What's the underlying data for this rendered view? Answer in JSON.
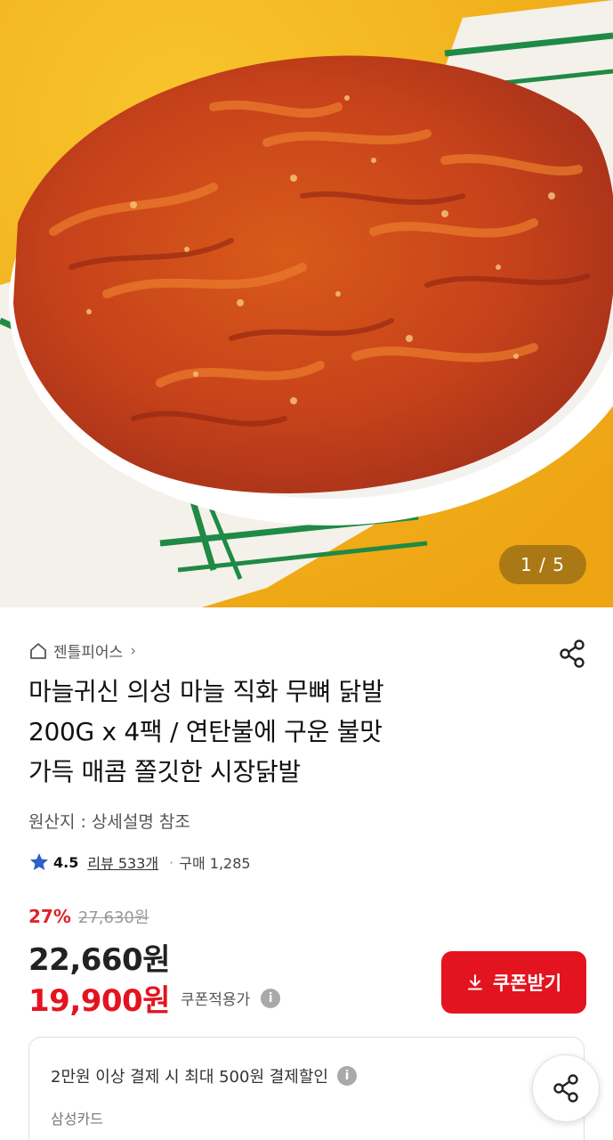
{
  "gallery": {
    "current": "1",
    "total": "5",
    "counter_text": "1 / 5"
  },
  "product": {
    "brand": "젠틀피어스",
    "title_lines": [
      "마늘귀신 의성 마늘 직화 무뼈 닭발",
      "200G x 4팩 / 연탄불에 구운 불맛",
      "가득 매콤 쫄깃한 시장닭발"
    ],
    "origin": "원산지 : 상세설명 참조",
    "rating": "4.5",
    "review_text": "리뷰 533개",
    "purchase_text": "구매 1,285",
    "discount_rate": "27%",
    "original_price": "27,630원",
    "sale_price": "22,660원",
    "coupon_price": "19,900원",
    "coupon_note": "쿠폰적용가"
  },
  "actions": {
    "coupon_button": "쿠폰받기"
  },
  "card_benefit": {
    "text": "2만원 이상 결제 시 최대 500원 결제할인",
    "card_name": "삼성카드"
  },
  "colors": {
    "accent_red": "#e3141f",
    "hero_background": "#f2b31c",
    "star_blue": "#2f5fc8"
  },
  "icons": {
    "brand": "home-icon",
    "share": "share-icon",
    "rating": "star-icon",
    "coupon": "download-icon",
    "info": "info-icon"
  }
}
